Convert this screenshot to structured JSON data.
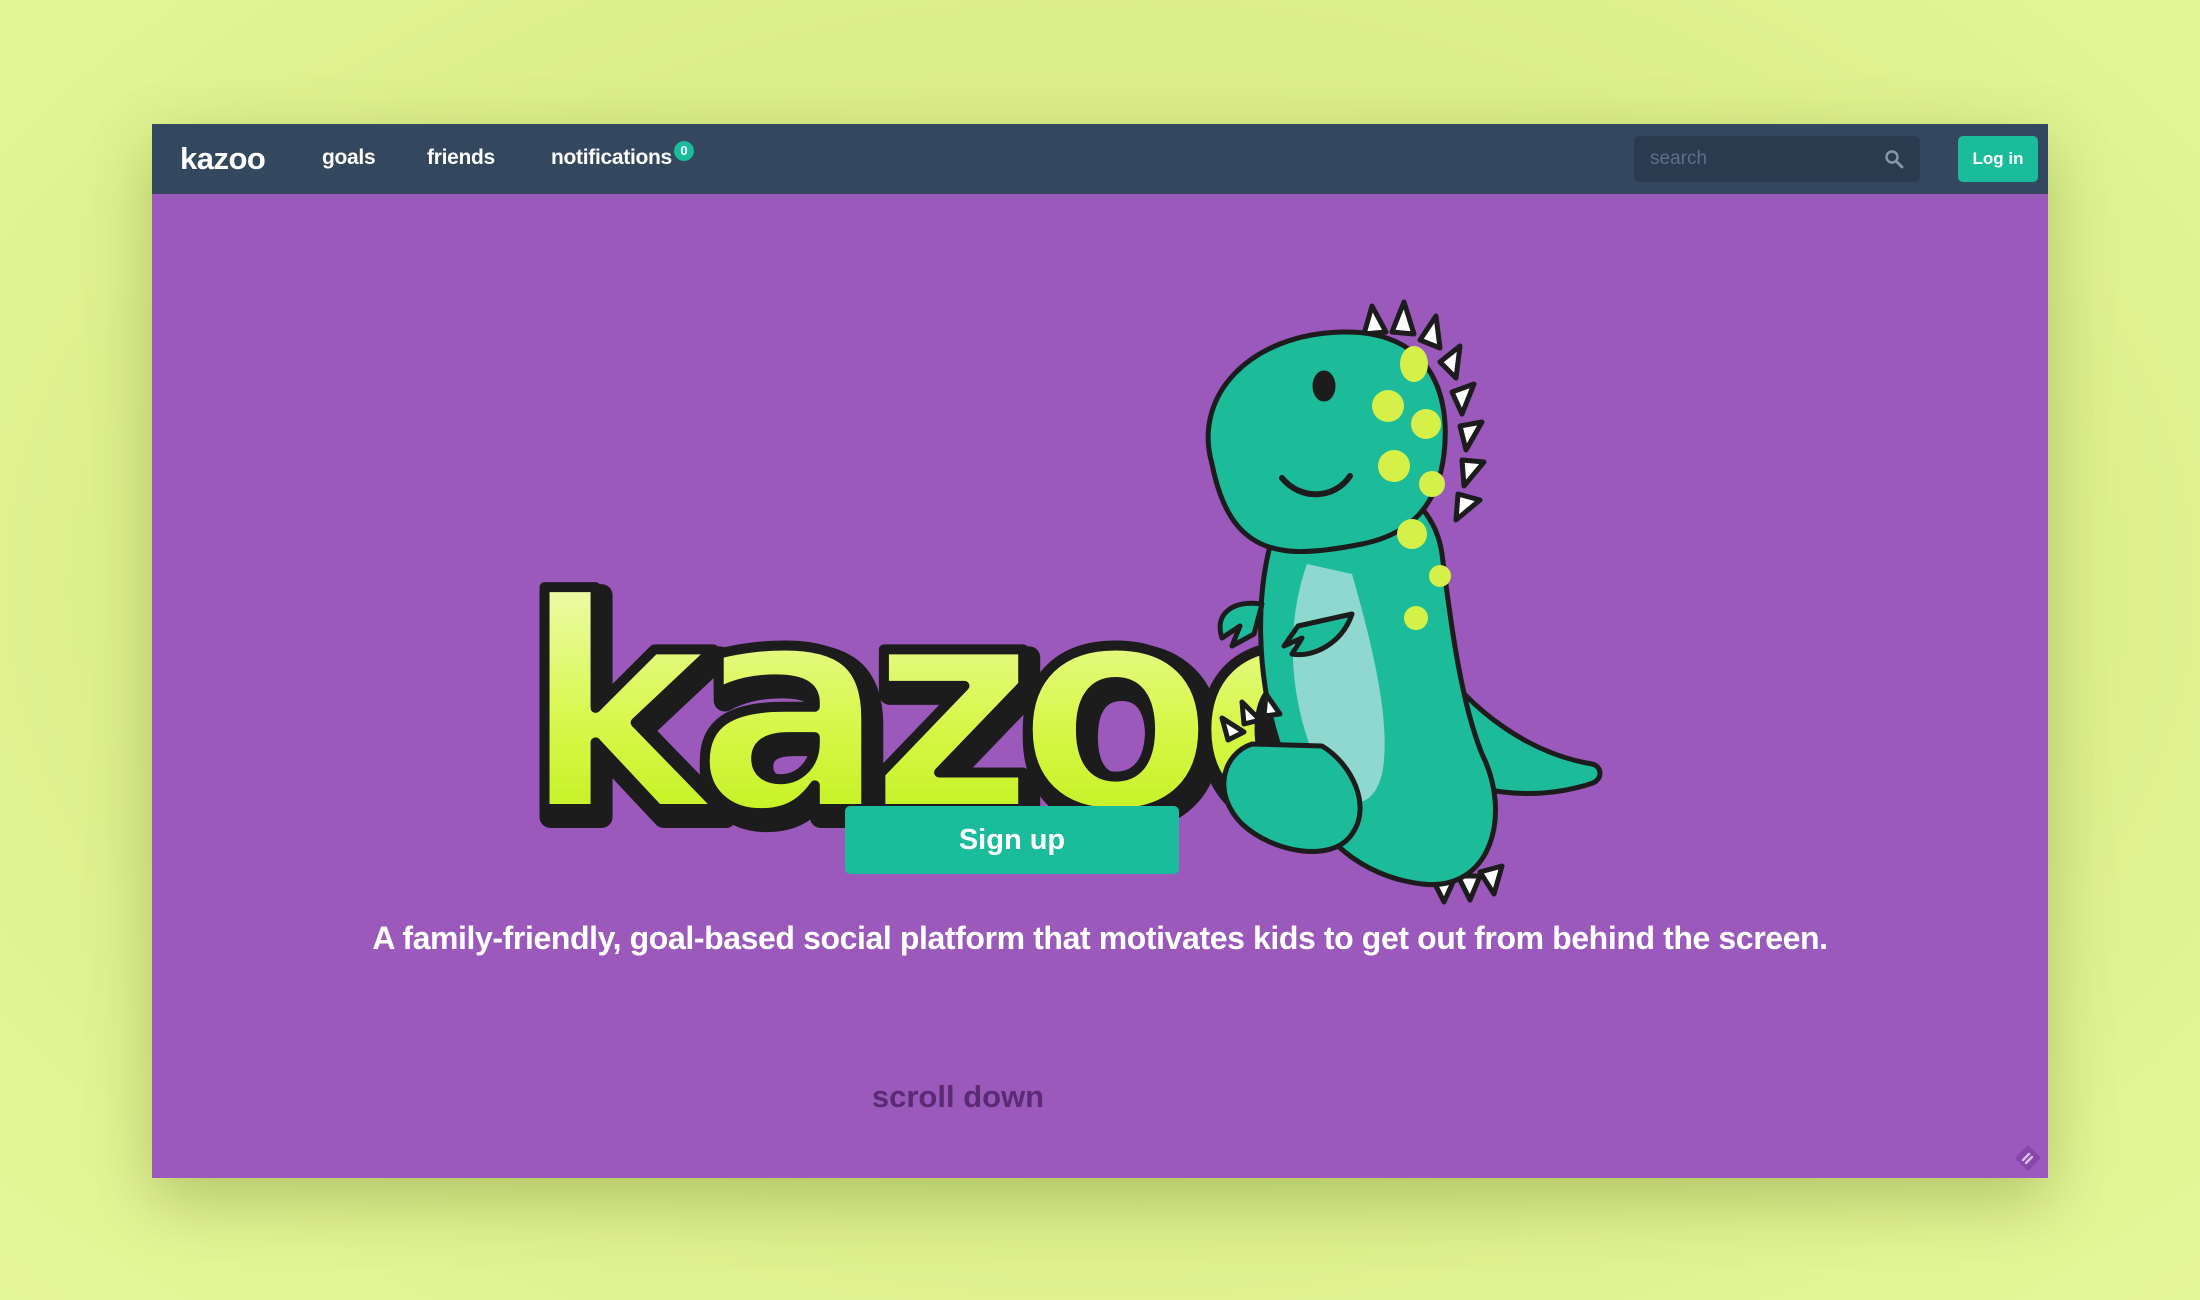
{
  "navbar": {
    "brand": "kazoo",
    "links": [
      {
        "label": "goals"
      },
      {
        "label": "friends"
      },
      {
        "label": "notifications"
      }
    ],
    "notification_count": "0",
    "search": {
      "placeholder": "search",
      "value": ""
    },
    "login_label": "Log in"
  },
  "hero": {
    "logo_text": "kazoo",
    "signup_label": "Sign up",
    "tagline": "A family-friendly, goal-based social platform that motivates kids to get out from behind the screen.",
    "scroll_label": "scroll down"
  },
  "colors": {
    "page_background": "#dcee88",
    "navbar": "#33475e",
    "hero_background": "#9a59bb",
    "accent": "#1abc9c",
    "logo_green": "#c8f51a",
    "dino_teal": "#1cbc9b",
    "scroll_text": "#5a2a74"
  },
  "icons": [
    "search-icon",
    "dinosaur-mascot",
    "corner-widget-icon"
  ]
}
